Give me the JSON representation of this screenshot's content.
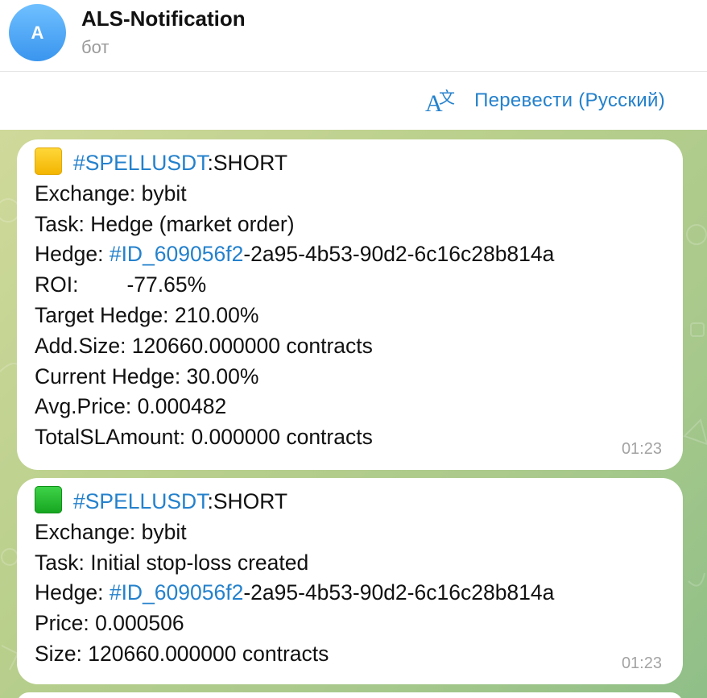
{
  "header": {
    "avatar_initial": "A",
    "title": "ALS-Notification",
    "subtitle": "бот"
  },
  "translate": {
    "icon": "translate-icon",
    "label": "Перевести (Русский)"
  },
  "colors": {
    "accent": "#2481cc",
    "bubble": "#ffffff",
    "wallpaper": "#b9cf8c"
  },
  "messages": [
    {
      "emoji": "yellow-square",
      "symbol_tag": "#SPELLUSDT",
      "side": ":SHORT",
      "exchange": "Exchange: bybit",
      "task": "Task: Hedge (market order)",
      "hedge_label": "Hedge: ",
      "hedge_tag": "#ID_609056f2",
      "hedge_rest": "-2a95-4b53-90d2-6c16c28b814a",
      "roi_label": "ROI:",
      "roi_value": "-77.65%",
      "target_hedge": "Target Hedge: 210.00%",
      "add_size": "Add.Size:  120660.000000 contracts",
      "current_hedge": "Current Hedge: 30.00%",
      "avg_price": "Avg.Price: 0.000482",
      "total_sl": "TotalSLAmount: 0.000000 contracts",
      "time": "01:23"
    },
    {
      "emoji": "green-square",
      "symbol_tag": "#SPELLUSDT",
      "side": ":SHORT",
      "exchange": "Exchange: bybit",
      "task": "Task: Initial stop-loss created",
      "hedge_label": "Hedge: ",
      "hedge_tag": "#ID_609056f2",
      "hedge_rest": "-2a95-4b53-90d2-6c16c28b814a",
      "price": "Price: 0.000506",
      "size": "Size:  120660.000000 contracts",
      "time": "01:23"
    }
  ]
}
